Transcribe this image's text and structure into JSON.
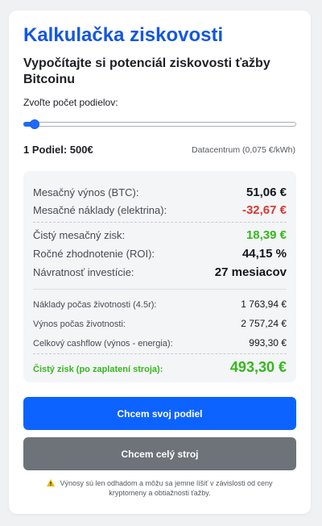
{
  "title": "Kalkulačka ziskovosti",
  "subtitle": "Vypočítajte si potenciál ziskovosti ťažby Bitcoinu",
  "slider": {
    "label": "Zvoľte počet podielov:",
    "value": 1,
    "fraction": 0.04
  },
  "share": {
    "summary": "1 Podiel: 500€",
    "datacenter": "Datacentrum (0,075 €/kWh)"
  },
  "results": {
    "monthly_revenue": {
      "label": "Mesačný výnos (BTC):",
      "value": "51,06 €"
    },
    "monthly_costs": {
      "label": "Mesačné náklady (elektrina):",
      "value": "-32,67 €"
    },
    "net_monthly": {
      "label": "Čistý mesačný zisk:",
      "value": "18,39 €"
    },
    "roi": {
      "label": "Ročné zhodnotenie (ROI):",
      "value": "44,15 %"
    },
    "payback": {
      "label": "Návratnosť investície:",
      "value": "27 mesiacov"
    },
    "lifetime_costs": {
      "label": "Náklady počas životnosti (4.5r):",
      "value": "1 763,94 €"
    },
    "lifetime_revenue": {
      "label": "Výnos počas životnosti:",
      "value": "2 757,24 €"
    },
    "cashflow": {
      "label": "Celkový cashflow (výnos - energia):",
      "value": "993,30 €"
    },
    "net_profit": {
      "label": "Čistý zisk (po zaplatení stroja):",
      "value": "493,30 €"
    }
  },
  "buttons": {
    "share": "Chcem svoj podiel",
    "machine": "Chcem celý stroj"
  },
  "note": "Výnosy sú len odhadom a môžu sa jemne líšiť v závislosti od ceny kryptomeny a obtiažnosti ťažby.",
  "icons": {
    "warning": "warning-icon"
  },
  "colors": {
    "brand": "#1457e0",
    "primary_button": "#0d63ff",
    "secondary_button": "#6d7379",
    "negative": "#d63a34",
    "positive": "#36b81c"
  }
}
